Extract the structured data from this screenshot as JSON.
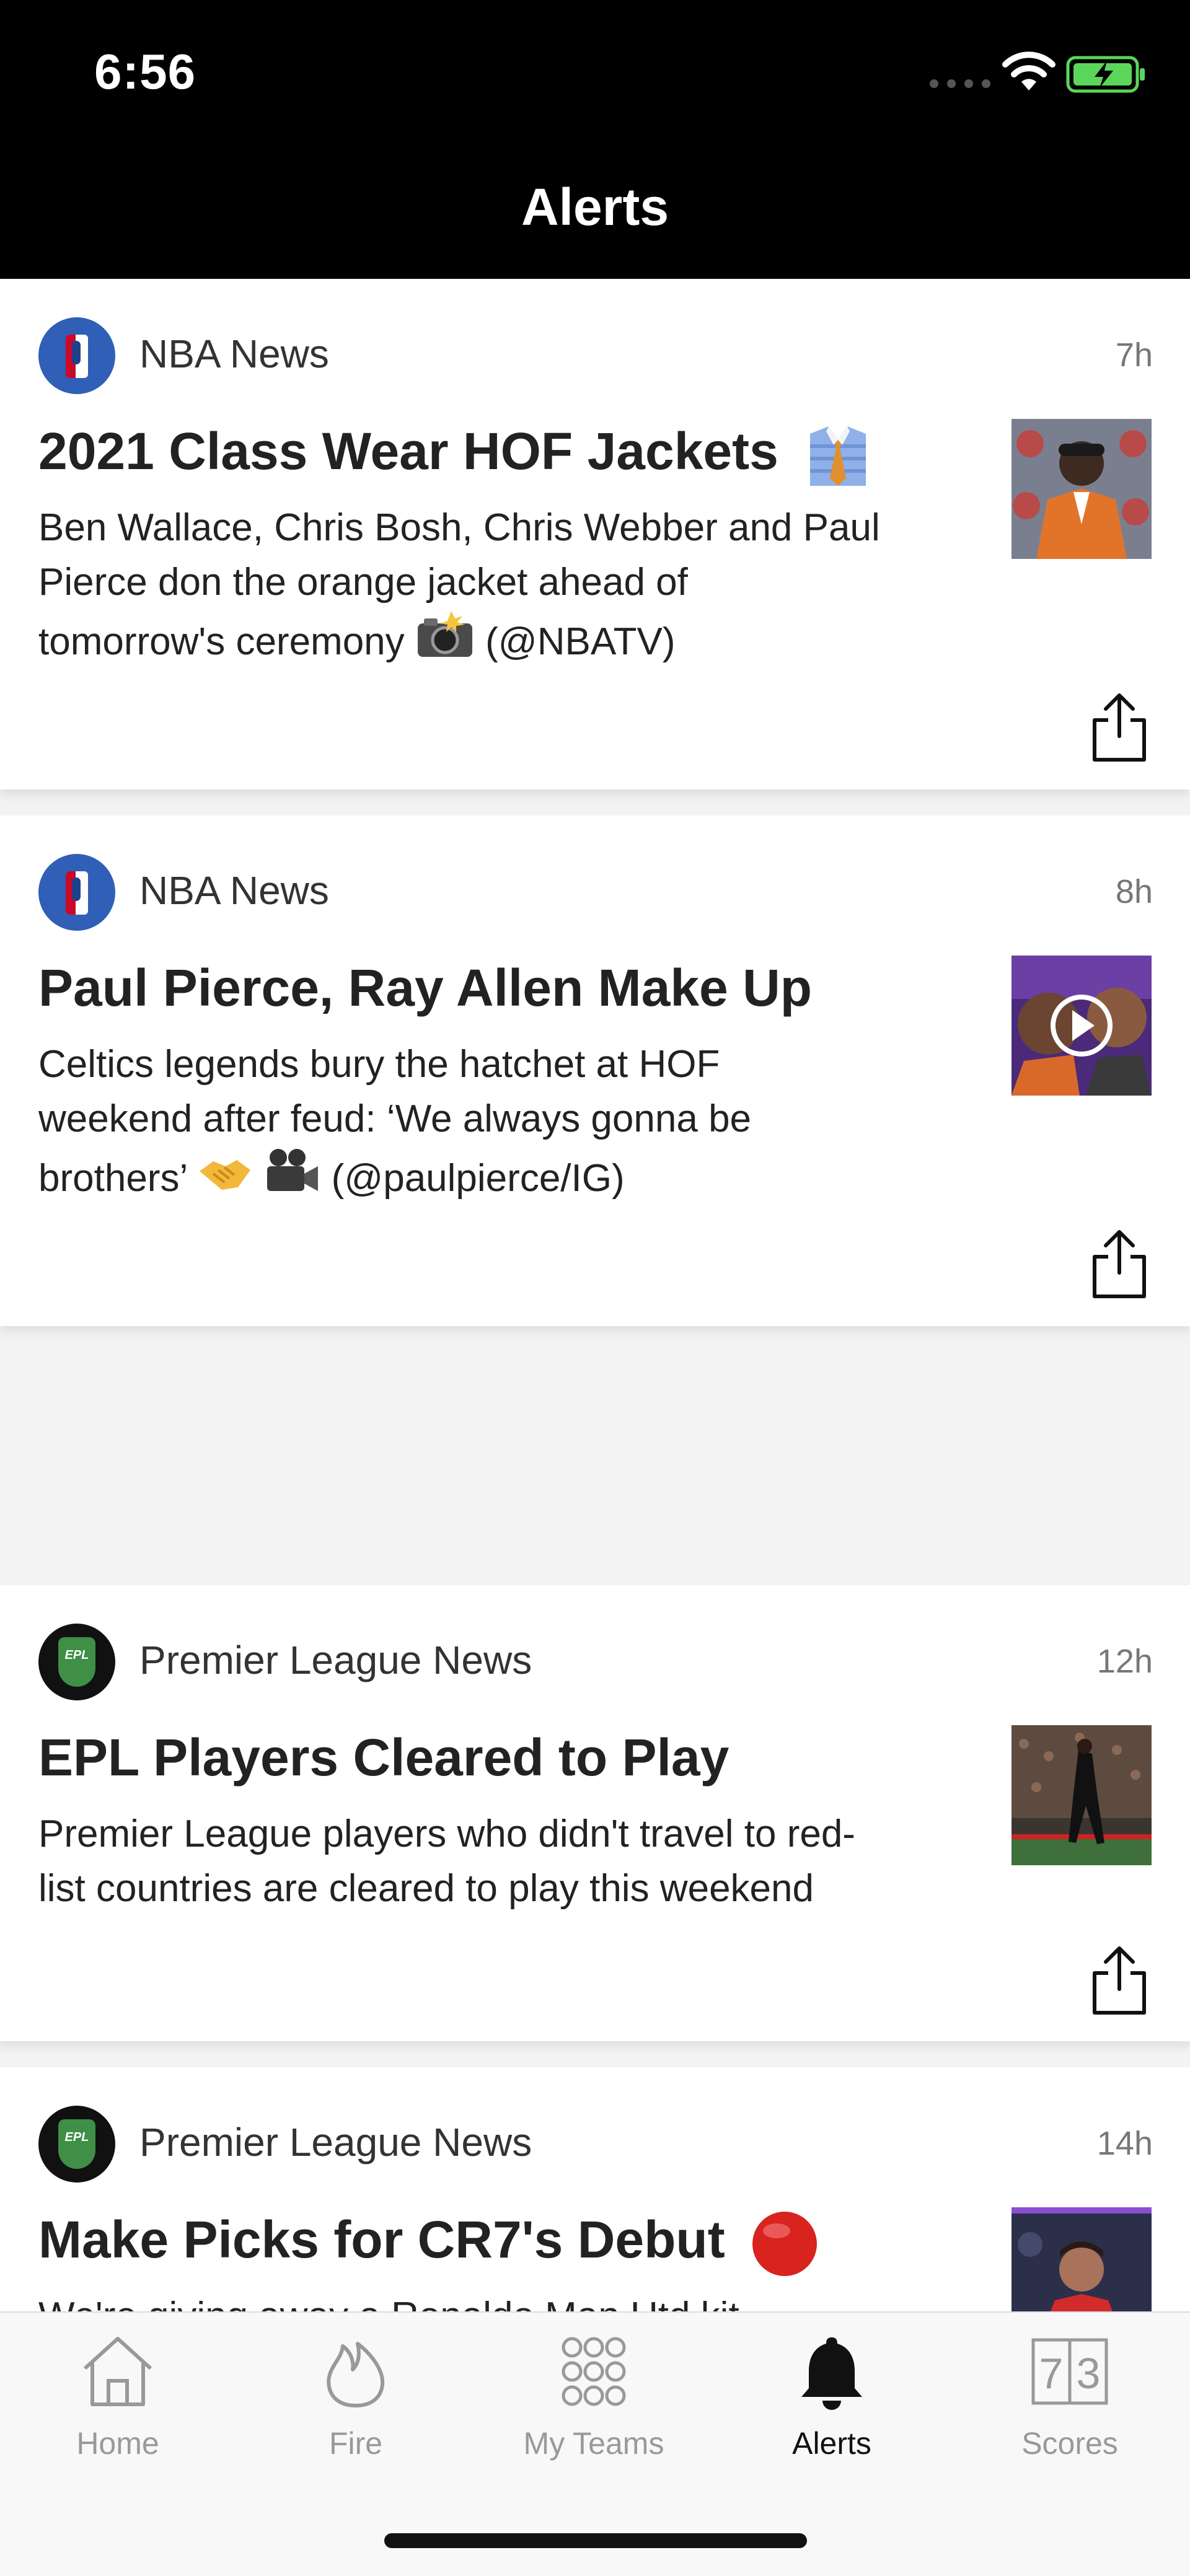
{
  "status_bar": {
    "time": "6:56"
  },
  "header": {
    "title": "Alerts"
  },
  "alerts": [
    {
      "source": "NBA News",
      "time": "7h",
      "headline": "2021 Class Wear HOF Jackets",
      "summary_lines": [
        "Ben Wallace, Chris Bosh, Chris Webber and Paul",
        "Pierce don the orange jacket ahead of"
      ],
      "summary_tail_before": "tomorrow's ceremony",
      "summary_tail_after": "(@NBATV)"
    },
    {
      "source": "NBA News",
      "time": "8h",
      "headline": "Paul Pierce, Ray Allen Make Up",
      "summary_lines": [
        "Celtics legends bury the hatchet at HOF",
        "weekend after feud: ‘We always gonna be"
      ],
      "summary_tail_before": "brothers’",
      "summary_tail_after": "(@paulpierce/IG)"
    },
    {
      "source": "Premier League News",
      "time": "12h",
      "headline": "EPL Players Cleared to Play",
      "summary_lines": [
        "Premier League players who didn't travel to red-",
        "list countries are cleared to play this weekend"
      ]
    },
    {
      "source": "Premier League News",
      "time": "14h",
      "headline": "Make Picks for CR7's Debut",
      "summary_lines": [
        "We're giving away a Ronaldo Man Utd kit"
      ]
    }
  ],
  "bottom_nav": [
    {
      "label": "Home",
      "icon": "home-icon"
    },
    {
      "label": "Fire",
      "icon": "fire-icon"
    },
    {
      "label": "My Teams",
      "icon": "grid-icon"
    },
    {
      "label": "Alerts",
      "icon": "bell-icon",
      "active": true
    },
    {
      "label": "Scores",
      "icon": "scoreboard-icon"
    }
  ],
  "scores_icon_digits": [
    "7",
    "3"
  ],
  "colors": {
    "nba_blue": "#2f5fb6",
    "epl_green": "#3f8f46",
    "header_bg": "#000000"
  }
}
